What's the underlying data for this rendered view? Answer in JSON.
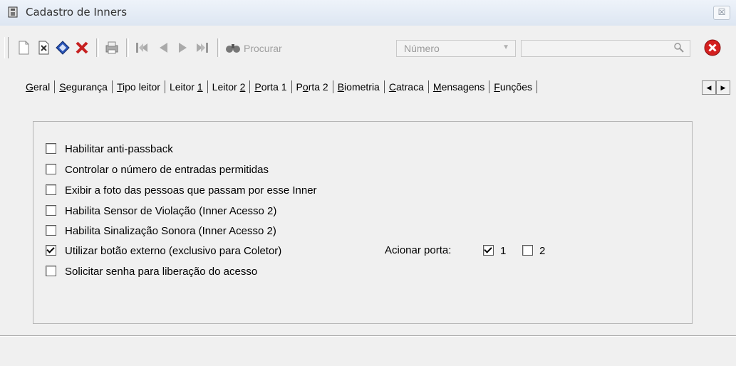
{
  "window": {
    "title": "Cadastro de Inners",
    "close_glyph": "☒"
  },
  "toolbar": {
    "buttons": [
      "new-icon",
      "edit-icon",
      "save-icon",
      "delete-icon",
      "print-icon",
      "first-icon",
      "prev-icon",
      "next-icon",
      "last-icon"
    ],
    "search_label": "Procurar",
    "field_select": "Número",
    "search_value": ""
  },
  "tabs": [
    {
      "pre": "",
      "u": "G",
      "post": "eral"
    },
    {
      "pre": "",
      "u": "S",
      "post": "egurança"
    },
    {
      "pre": "",
      "u": "T",
      "post": "ipo leitor"
    },
    {
      "pre": "Leitor ",
      "u": "1",
      "post": ""
    },
    {
      "pre": "Leitor ",
      "u": "2",
      "post": ""
    },
    {
      "pre": "",
      "u": "P",
      "post": "orta 1"
    },
    {
      "pre": "P",
      "u": "o",
      "post": "rta 2"
    },
    {
      "pre": "",
      "u": "B",
      "post": "iometria"
    },
    {
      "pre": "",
      "u": "C",
      "post": "atraca"
    },
    {
      "pre": "",
      "u": "M",
      "post": "ensagens"
    },
    {
      "pre": "",
      "u": "F",
      "post": "unções"
    }
  ],
  "options": [
    {
      "label": "Habilitar anti-passback",
      "checked": false
    },
    {
      "label": "Controlar o número de entradas permitidas",
      "checked": false
    },
    {
      "label": "Exibir a foto das pessoas que passam por esse Inner",
      "checked": false
    },
    {
      "label": "Habilita Sensor de Violação (Inner Acesso 2)",
      "checked": false
    },
    {
      "label": "Habilita Sinalização Sonora (Inner Acesso 2)",
      "checked": false
    },
    {
      "label": "Utilizar botão externo (exclusivo para Coletor)",
      "checked": true
    },
    {
      "label": "Solicitar senha para liberação do acesso",
      "checked": false
    }
  ],
  "acionar_porta": {
    "label": "Acionar porta:",
    "ports": [
      {
        "label": "1",
        "checked": true
      },
      {
        "label": "2",
        "checked": false
      }
    ]
  }
}
